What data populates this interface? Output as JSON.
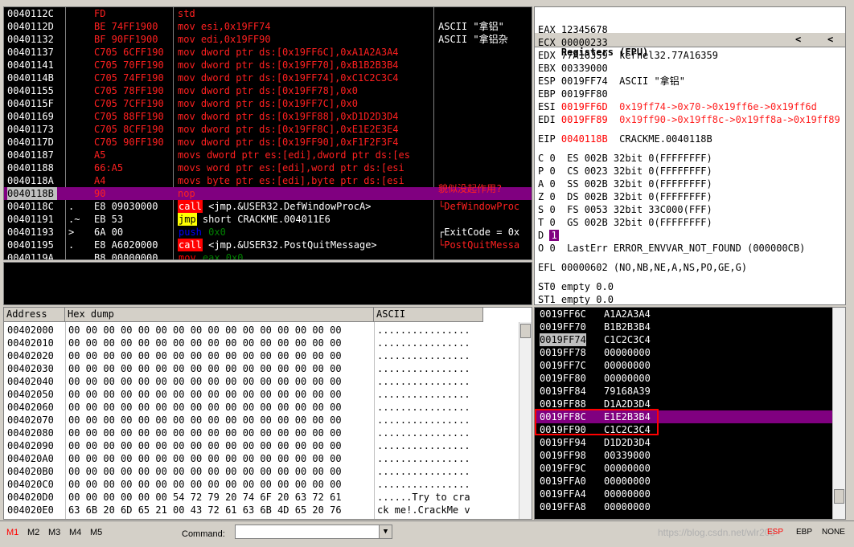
{
  "disasm": [
    {
      "addr": "0040112C",
      "mark": "",
      "hex": "FD",
      "instr": "std",
      "kind": "red"
    },
    {
      "addr": "0040112D",
      "mark": "",
      "hex": "BE 74FF1900",
      "instr": "mov esi,0x19FF74",
      "kind": "red"
    },
    {
      "addr": "00401132",
      "mark": "",
      "hex": "BF 90FF1900",
      "instr": "mov edi,0x19FF90",
      "kind": "red"
    },
    {
      "addr": "00401137",
      "mark": "",
      "hex": "C705 6CFF190",
      "instr": "mov dword ptr ds:[0x19FF6C],0xA1A2A3A4",
      "kind": "red"
    },
    {
      "addr": "00401141",
      "mark": "",
      "hex": "C705 70FF190",
      "instr": "mov dword ptr ds:[0x19FF70],0xB1B2B3B4",
      "kind": "red"
    },
    {
      "addr": "0040114B",
      "mark": "",
      "hex": "C705 74FF190",
      "instr": "mov dword ptr ds:[0x19FF74],0xC1C2C3C4",
      "kind": "red"
    },
    {
      "addr": "00401155",
      "mark": "",
      "hex": "C705 78FF190",
      "instr": "mov dword ptr ds:[0x19FF78],0x0",
      "kind": "red"
    },
    {
      "addr": "0040115F",
      "mark": "",
      "hex": "C705 7CFF190",
      "instr": "mov dword ptr ds:[0x19FF7C],0x0",
      "kind": "red"
    },
    {
      "addr": "00401169",
      "mark": "",
      "hex": "C705 88FF190",
      "instr": "mov dword ptr ds:[0x19FF88],0xD1D2D3D4",
      "kind": "red"
    },
    {
      "addr": "00401173",
      "mark": "",
      "hex": "C705 8CFF190",
      "instr": "mov dword ptr ds:[0x19FF8C],0xE1E2E3E4",
      "kind": "red"
    },
    {
      "addr": "0040117D",
      "mark": "",
      "hex": "C705 90FF190",
      "instr": "mov dword ptr ds:[0x19FF90],0xF1F2F3F4",
      "kind": "red"
    },
    {
      "addr": "00401187",
      "mark": "",
      "hex": "A5",
      "instr": "movs dword ptr es:[edi],dword ptr ds:[es",
      "kind": "red"
    },
    {
      "addr": "00401188",
      "mark": "",
      "hex": "66:A5",
      "instr": "movs word ptr es:[edi],word ptr ds:[esi",
      "kind": "red"
    },
    {
      "addr": "0040118A",
      "mark": "",
      "hex": "A4",
      "instr": "movs byte ptr es:[edi],byte ptr ds:[esi",
      "kind": "red"
    },
    {
      "addr": "0040118B",
      "mark": "",
      "hex": "90",
      "instr": "nop",
      "kind": "sel"
    },
    {
      "addr": "0040118C",
      "mark": ".",
      "hex": "E8 09030000",
      "tag": "call",
      "instr": " <jmp.&USER32.DefWindowProcA>",
      "kind": "call"
    },
    {
      "addr": "00401191",
      "mark": ".~",
      "hex": "EB 53",
      "tag": "jmp",
      "instr": " short CRACKME.004011E6",
      "kind": "jmp"
    },
    {
      "addr": "00401193",
      "mark": ">",
      "hex": "6A 00",
      "tag": "push",
      "instr": " 0x0",
      "kind": "push"
    },
    {
      "addr": "00401195",
      "mark": ".",
      "hex": "E8 A6020000",
      "tag": "call",
      "instr": " <jmp.&USER32.PostQuitMessage>",
      "kind": "call"
    },
    {
      "addr": "0040119A",
      "mark": ".",
      "hex": "B8 00000000",
      "tag": "mov",
      "instr": " eax,0x0",
      "kind": "mov"
    }
  ],
  "disasm_comments": [
    {
      "text": "ASCII \"拿铝\"",
      "row": 1,
      "color": "white"
    },
    {
      "text": "ASCII \"拿铝杂",
      "row": 2,
      "color": "white"
    },
    {
      "text": "貌似没起作用?",
      "row": 13.6,
      "color": "red"
    },
    {
      "text": "└DefWindowProc",
      "row": 15,
      "color": "red"
    },
    {
      "text": "┌ExitCode = 0x",
      "row": 17,
      "color": "white"
    },
    {
      "text": "└PostQuitMessa",
      "row": 18,
      "color": "red"
    }
  ],
  "registers": {
    "title": "Registers (FPU)",
    "arrows": [
      "<",
      "<"
    ],
    "general": [
      {
        "name": "EAX",
        "value": "12345678",
        "note": "",
        "red": false
      },
      {
        "name": "ECX",
        "value": "00000233",
        "note": "",
        "red": false
      },
      {
        "name": "EDX",
        "value": "77A16359",
        "note": "kernel32.77A16359",
        "red": false
      },
      {
        "name": "EBX",
        "value": "00339000",
        "note": "",
        "red": false
      },
      {
        "name": "ESP",
        "value": "0019FF74",
        "note": "ASCII \"拿铝\"",
        "red": false
      },
      {
        "name": "EBP",
        "value": "0019FF80",
        "note": "",
        "red": false
      },
      {
        "name": "ESI",
        "value": "0019FF6D",
        "note": "0x19ff74->0x70->0x19ff6e->0x19ff6d",
        "red": true
      },
      {
        "name": "EDI",
        "value": "0019FF89",
        "note": "0x19ff90->0x19ff8c->0x19ff8a->0x19ff89",
        "red": true
      }
    ],
    "eip": {
      "name": "EIP",
      "value": "0040118B",
      "note": "CRACKME.0040118B"
    },
    "flags": [
      {
        "f": "C",
        "v": "0",
        "seg": "ES",
        "sv": "002B",
        "desc": "32bit 0(FFFFFFFF)"
      },
      {
        "f": "P",
        "v": "0",
        "seg": "CS",
        "sv": "0023",
        "desc": "32bit 0(FFFFFFFF)"
      },
      {
        "f": "A",
        "v": "0",
        "seg": "SS",
        "sv": "002B",
        "desc": "32bit 0(FFFFFFFF)"
      },
      {
        "f": "Z",
        "v": "0",
        "seg": "DS",
        "sv": "002B",
        "desc": "32bit 0(FFFFFFFF)"
      },
      {
        "f": "S",
        "v": "0",
        "seg": "FS",
        "sv": "0053",
        "desc": "32bit 33C000(FFF)"
      },
      {
        "f": "T",
        "v": "0",
        "seg": "GS",
        "sv": "002B",
        "desc": "32bit 0(FFFFFFFF)"
      }
    ],
    "dflag": {
      "f": "D",
      "v": "1"
    },
    "oflag": {
      "f": "O",
      "v": "0",
      "text": "LastErr ERROR_ENVVAR_NOT_FOUND (000000CB)"
    },
    "efl": "EFL 00000602 (NO,NB,NE,A,NS,PO,GE,G)",
    "fpu": [
      "ST0 empty 0.0",
      "ST1 empty 0.0"
    ]
  },
  "dump": {
    "headers": {
      "address": "Address",
      "hex": "Hex dump",
      "ascii": "ASCII"
    },
    "rows": [
      {
        "addr": "00402000",
        "hex": "00 00 00 00 00 00 00 00 00 00 00 00 00 00 00 00",
        "ascii": "................"
      },
      {
        "addr": "00402010",
        "hex": "00 00 00 00 00 00 00 00 00 00 00 00 00 00 00 00",
        "ascii": "................"
      },
      {
        "addr": "00402020",
        "hex": "00 00 00 00 00 00 00 00 00 00 00 00 00 00 00 00",
        "ascii": "................"
      },
      {
        "addr": "00402030",
        "hex": "00 00 00 00 00 00 00 00 00 00 00 00 00 00 00 00",
        "ascii": "................"
      },
      {
        "addr": "00402040",
        "hex": "00 00 00 00 00 00 00 00 00 00 00 00 00 00 00 00",
        "ascii": "................"
      },
      {
        "addr": "00402050",
        "hex": "00 00 00 00 00 00 00 00 00 00 00 00 00 00 00 00",
        "ascii": "................"
      },
      {
        "addr": "00402060",
        "hex": "00 00 00 00 00 00 00 00 00 00 00 00 00 00 00 00",
        "ascii": "................"
      },
      {
        "addr": "00402070",
        "hex": "00 00 00 00 00 00 00 00 00 00 00 00 00 00 00 00",
        "ascii": "................"
      },
      {
        "addr": "00402080",
        "hex": "00 00 00 00 00 00 00 00 00 00 00 00 00 00 00 00",
        "ascii": "................"
      },
      {
        "addr": "00402090",
        "hex": "00 00 00 00 00 00 00 00 00 00 00 00 00 00 00 00",
        "ascii": "................"
      },
      {
        "addr": "004020A0",
        "hex": "00 00 00 00 00 00 00 00 00 00 00 00 00 00 00 00",
        "ascii": "................"
      },
      {
        "addr": "004020B0",
        "hex": "00 00 00 00 00 00 00 00 00 00 00 00 00 00 00 00",
        "ascii": "................"
      },
      {
        "addr": "004020C0",
        "hex": "00 00 00 00 00 00 00 00 00 00 00 00 00 00 00 00",
        "ascii": "................"
      },
      {
        "addr": "004020D0",
        "hex": "00 00 00 00 00 00 54 72 79 20 74 6F 20 63 72 61",
        "ascii": "......Try to cra"
      },
      {
        "addr": "004020E0",
        "hex": "63 6B 20 6D 65 21 00 43 72 61 63 6B 4D 65 20 76",
        "ascii": "ck me!.CrackMe v"
      }
    ]
  },
  "stack": {
    "rows": [
      {
        "addr": "0019FF6C",
        "val": "A1A2A3A4",
        "state": ""
      },
      {
        "addr": "0019FF70",
        "val": "B1B2B3B4",
        "state": ""
      },
      {
        "addr": "0019FF74",
        "val": "C1C2C3C4",
        "state": "esp"
      },
      {
        "addr": "0019FF78",
        "val": "00000000",
        "state": ""
      },
      {
        "addr": "0019FF7C",
        "val": "00000000",
        "state": ""
      },
      {
        "addr": "0019FF80",
        "val": "00000000",
        "state": ""
      },
      {
        "addr": "0019FF84",
        "val": "79168A39",
        "state": ""
      },
      {
        "addr": "0019FF88",
        "val": "D1A2D3D4",
        "state": ""
      },
      {
        "addr": "0019FF8C",
        "val": "E1E2B3B4",
        "state": "hl"
      },
      {
        "addr": "0019FF90",
        "val": "C1C2C3C4",
        "state": ""
      },
      {
        "addr": "0019FF94",
        "val": "D1D2D3D4",
        "state": ""
      },
      {
        "addr": "0019FF98",
        "val": "00339000",
        "state": ""
      },
      {
        "addr": "0019FF9C",
        "val": "00000000",
        "state": ""
      },
      {
        "addr": "0019FFA0",
        "val": "00000000",
        "state": ""
      },
      {
        "addr": "0019FFA4",
        "val": "00000000",
        "state": ""
      },
      {
        "addr": "0019FFA8",
        "val": "00000000",
        "state": ""
      }
    ]
  },
  "statusbar": {
    "tabs": [
      "M1",
      "M2",
      "M3",
      "M4",
      "M5"
    ],
    "active_tab": "M1",
    "command_label": "Command:",
    "command_value": "",
    "right": [
      "ESP",
      "EBP",
      "NONE"
    ],
    "watermark": "https://blog.csdn.net/wlr209"
  },
  "colors": {
    "selection": "#800080",
    "highlight_red": "#ff0000",
    "background": "#000000"
  }
}
